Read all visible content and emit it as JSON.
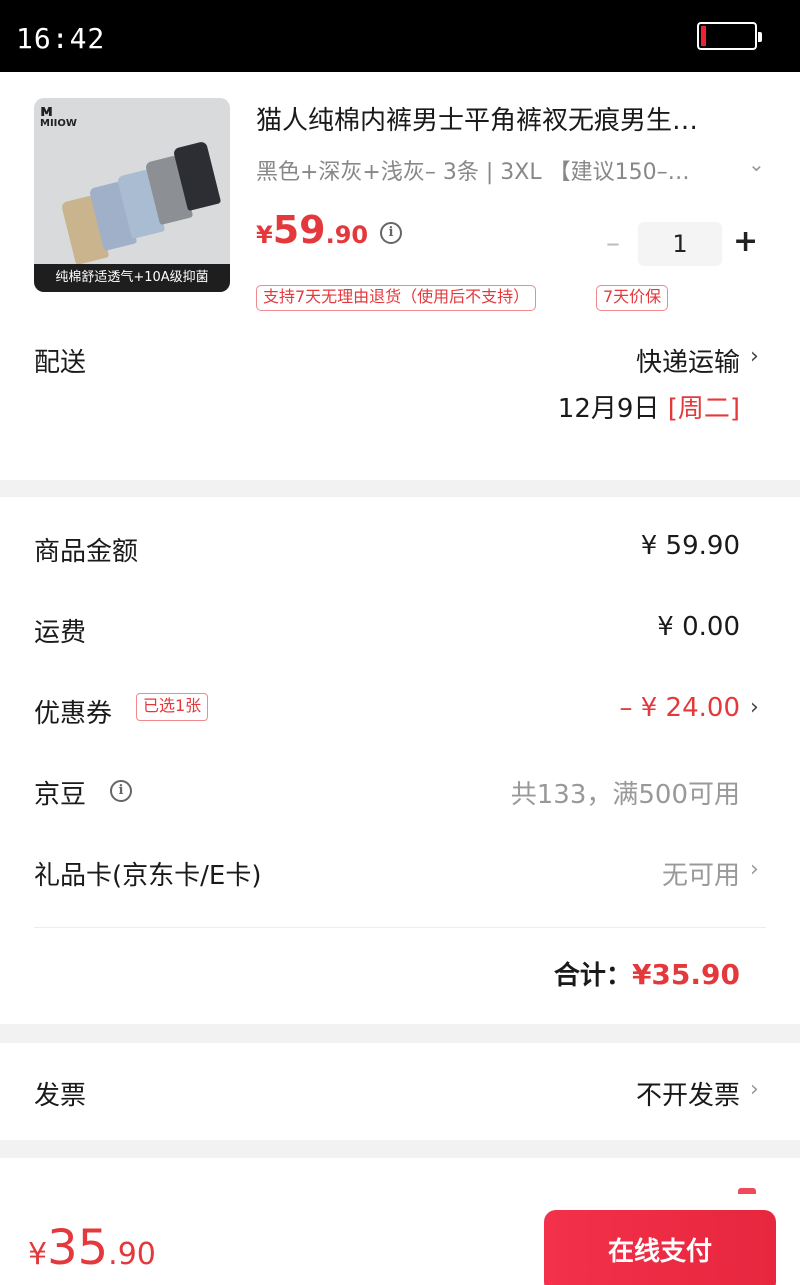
{
  "status_bar": {
    "time": "16:42"
  },
  "product": {
    "image": {
      "brand": "MIIOW",
      "band_text": "纯棉舒适透气+10A级抑菌"
    },
    "title": "猫人纯棉内裤男士平角裤衩无痕男生…",
    "spec": "黑色+深灰+浅灰– 3条 | 3XL 【建议150–…",
    "price": {
      "symbol": "¥",
      "integer": "59",
      "decimal": ".90"
    },
    "quantity": "1",
    "qty_minus": "–",
    "qty_plus": "+",
    "tags": [
      "支持7天无理由退货（使用后不支持）",
      "7天价保"
    ]
  },
  "delivery": {
    "label": "配送",
    "method": "快递运输",
    "date": "12月9日 ",
    "weekday": "[周二]"
  },
  "summary": {
    "goods_amount": {
      "label": "商品金额",
      "value": "¥ 59.90"
    },
    "shipping": {
      "label": "运费",
      "value": "¥ 0.00"
    },
    "coupon": {
      "label": "优惠券",
      "tag": "已选1张",
      "value": "– ¥ 24.00"
    },
    "beans": {
      "label": "京豆",
      "value": "共133，满500可用"
    },
    "gift_card": {
      "label": "礼品卡(京东卡/E卡)",
      "value": "无可用"
    },
    "total": {
      "label": "合计：",
      "value": "¥35.90"
    }
  },
  "invoice": {
    "label": "发票",
    "value": "不开发票"
  },
  "footer": {
    "price": {
      "symbol": "¥",
      "integer": "35",
      "decimal": ".90"
    },
    "pay_button": "在线支付"
  },
  "colors": {
    "accent": "#e4393c",
    "page_background": "#f2f2f2",
    "status_bar": "#000000"
  }
}
